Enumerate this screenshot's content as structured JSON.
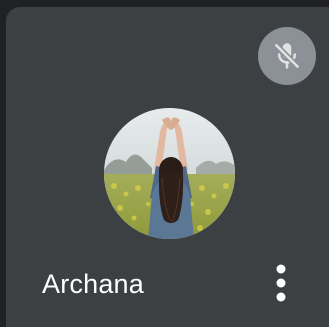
{
  "participant": {
    "name": "Archana",
    "muted": true
  },
  "icons": {
    "mute": "mic-off-icon",
    "more": "more-vert-icon"
  },
  "colors": {
    "background": "#202124",
    "tile": "#3c4043",
    "mute_badge": "#9aa0a6",
    "text": "#ffffff"
  }
}
